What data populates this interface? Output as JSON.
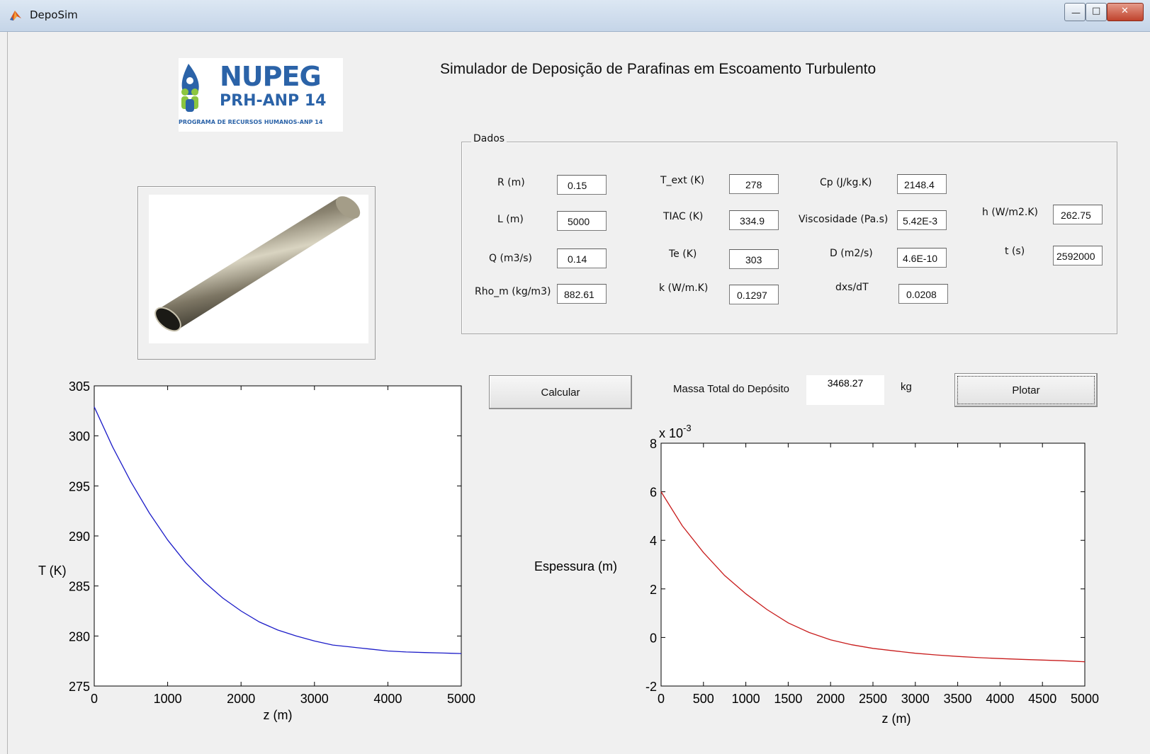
{
  "window": {
    "title": "DepoSim"
  },
  "logo": {
    "text_main": "NUPEG",
    "text_sub": "PRH-ANP 14",
    "caption": "PROGRAMA DE RECURSOS HUMANOS-ANP 14"
  },
  "header": {
    "title": "Simulador de Deposição de Parafinas em Escoamento Turbulento"
  },
  "dados": {
    "title": "Dados",
    "fields": [
      {
        "label": "R (m)",
        "value": "0.15"
      },
      {
        "label": "L (m)",
        "value": "5000"
      },
      {
        "label": "Q (m3/s)",
        "value": "0.14"
      },
      {
        "label": "Rho_m (kg/m3)",
        "value": "882.61"
      },
      {
        "label": "T_ext (K)",
        "value": "278"
      },
      {
        "label": "TIAC (K)",
        "value": "334.9"
      },
      {
        "label": "Te (K)",
        "value": "303"
      },
      {
        "label": "k (W/m.K)",
        "value": "0.1297"
      },
      {
        "label": "Cp (J/kg.K)",
        "value": "2148.4"
      },
      {
        "label": "Viscosidade (Pa.s)",
        "value": "5.42E-3"
      },
      {
        "label": "D (m2/s)",
        "value": "4.6E-10"
      },
      {
        "label": "dxs/dT",
        "value": "0.0208"
      },
      {
        "label": "h (W/m2.K)",
        "value": "262.75"
      },
      {
        "label": "t (s)",
        "value": "2592000"
      }
    ]
  },
  "actions": {
    "calcular": "Calcular",
    "massa_label": "Massa Total do Depósito",
    "massa_value": "3468.27",
    "massa_unit": "kg",
    "plotar": "Plotar"
  },
  "chart_data": [
    {
      "type": "line",
      "xlabel": "z (m)",
      "ylabel": "T (K)",
      "xlim": [
        0,
        5000
      ],
      "ylim": [
        275,
        305
      ],
      "xticks": [
        0,
        1000,
        2000,
        3000,
        4000,
        5000
      ],
      "yticks": [
        275,
        280,
        285,
        290,
        295,
        300,
        305
      ],
      "color": "#1c1cc8",
      "x": [
        0,
        250,
        500,
        750,
        1000,
        1250,
        1500,
        1750,
        2000,
        2250,
        2500,
        2750,
        3000,
        3250,
        3500,
        3750,
        4000,
        4250,
        4500,
        4750,
        5000
      ],
      "y": [
        302.9,
        298.9,
        295.4,
        292.3,
        289.6,
        287.3,
        285.4,
        283.8,
        282.5,
        281.4,
        280.6,
        280.0,
        279.5,
        279.1,
        278.9,
        278.7,
        278.5,
        278.4,
        278.35,
        278.3,
        278.25
      ]
    },
    {
      "type": "line",
      "xlabel": "z (m)",
      "ylabel": "Espessura (m)",
      "multiplier": "x 10",
      "multiplier_exp": "-3",
      "xlim": [
        0,
        5000
      ],
      "ylim": [
        -2,
        8
      ],
      "xticks": [
        0,
        500,
        1000,
        1500,
        2000,
        2500,
        3000,
        3500,
        4000,
        4500,
        5000
      ],
      "yticks": [
        -2,
        0,
        2,
        4,
        6,
        8
      ],
      "color": "#c81c1c",
      "x": [
        0,
        250,
        500,
        750,
        1000,
        1250,
        1500,
        1750,
        2000,
        2250,
        2500,
        2750,
        3000,
        3250,
        3500,
        3750,
        4000,
        4250,
        4500,
        4750,
        5000
      ],
      "y": [
        6.0,
        4.6,
        3.5,
        2.55,
        1.8,
        1.15,
        0.6,
        0.2,
        -0.1,
        -0.3,
        -0.45,
        -0.55,
        -0.65,
        -0.72,
        -0.78,
        -0.83,
        -0.87,
        -0.9,
        -0.93,
        -0.96,
        -1.0
      ]
    }
  ]
}
